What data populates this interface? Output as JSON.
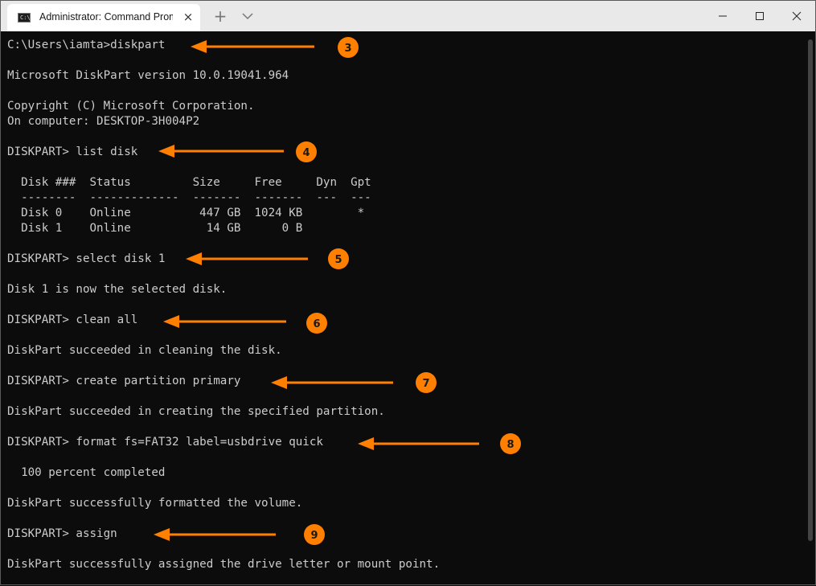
{
  "window": {
    "tab_title": "Administrator: Command Prompt",
    "tab_close": "×",
    "new_tab": "+"
  },
  "terminal": {
    "lines": [
      "C:\\Users\\iamta>diskpart",
      "Microsoft DiskPart version 10.0.19041.964",
      "Copyright (C) Microsoft Corporation.",
      "On computer: DESKTOP-3H004P2",
      "DISKPART> list disk",
      "  Disk ###  Status         Size     Free     Dyn  Gpt",
      "  --------  -------------  -------  -------  ---  ---",
      "  Disk 0    Online          447 GB  1024 KB        *",
      "  Disk 1    Online           14 GB      0 B",
      "DISKPART> select disk 1",
      "Disk 1 is now the selected disk.",
      "DISKPART> clean all",
      "DiskPart succeeded in cleaning the disk.",
      "DISKPART> create partition primary",
      "DiskPart succeeded in creating the specified partition.",
      "DISKPART> format fs=FAT32 label=usbdrive quick",
      "  100 percent completed",
      "DiskPart successfully formatted the volume.",
      "DISKPART> assign",
      "DiskPart successfully assigned the drive letter or mount point."
    ]
  },
  "annotations": {
    "badges": [
      "3",
      "4",
      "5",
      "6",
      "7",
      "8",
      "9"
    ],
    "color": "#ff7f00"
  }
}
